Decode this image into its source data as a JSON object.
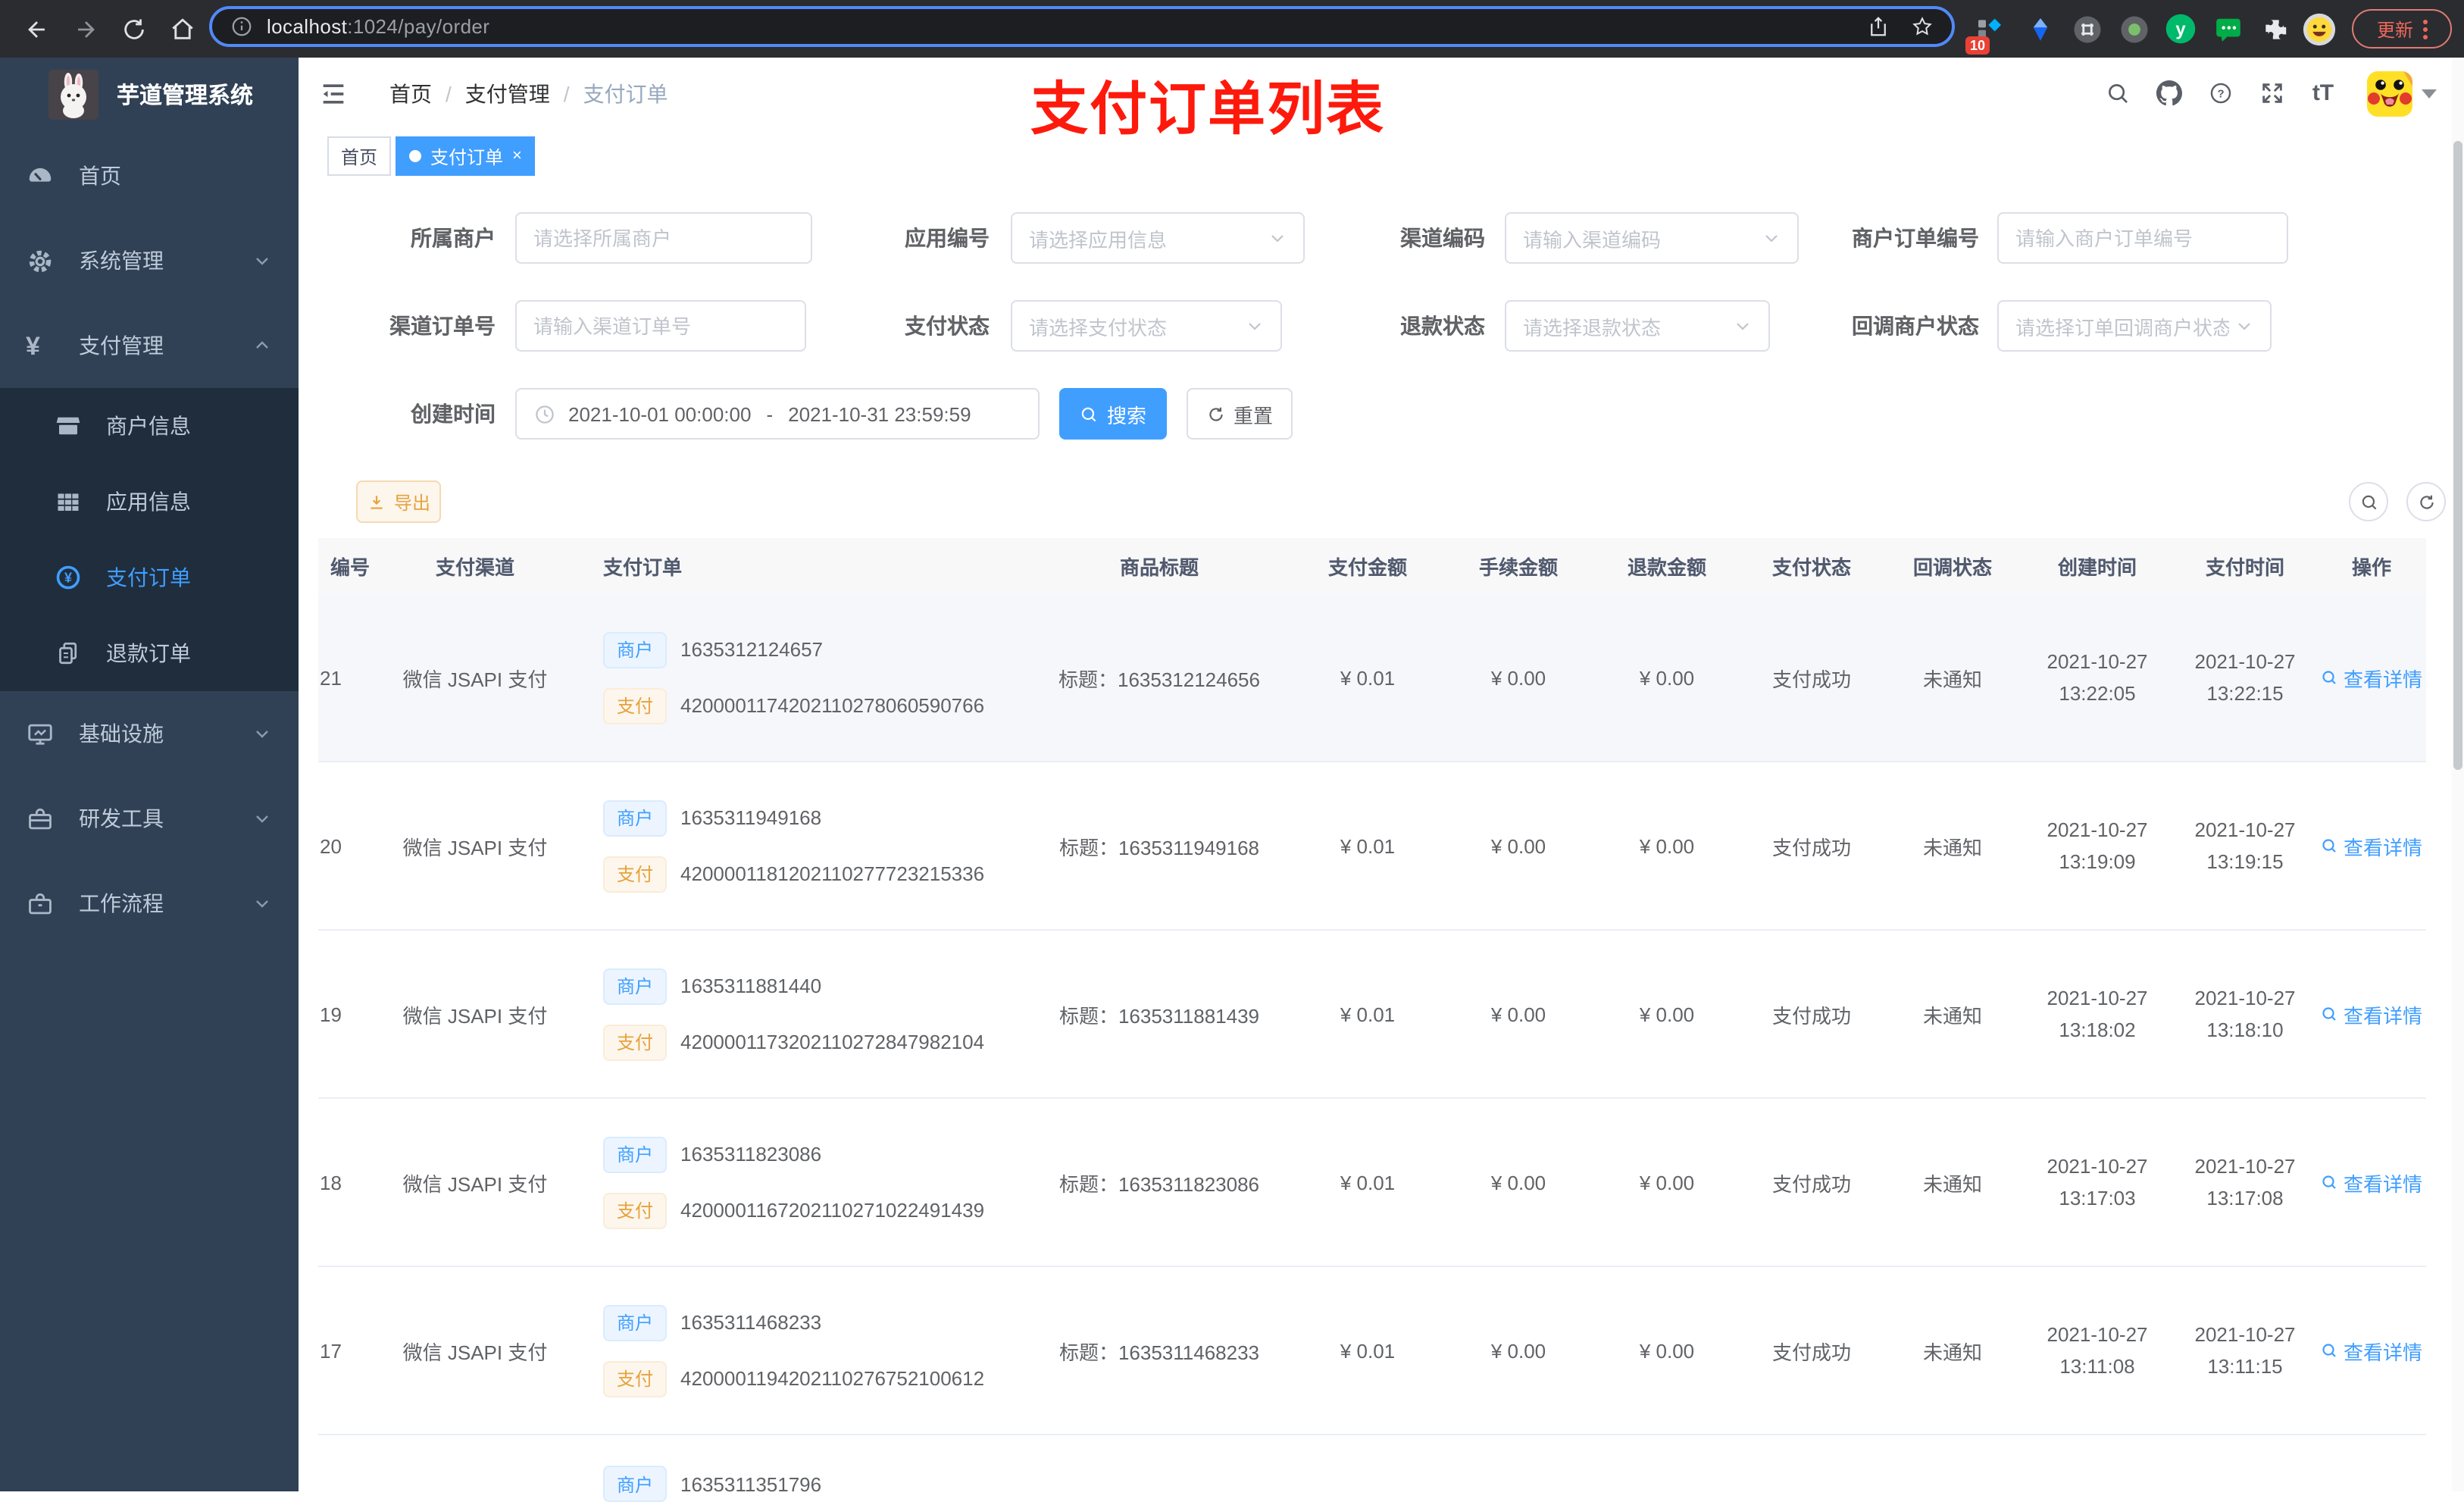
{
  "browser": {
    "url_host": "localhost",
    "url_path": ":1024/pay/order",
    "ext_badge": "10",
    "update_label": "更新"
  },
  "sidebar": {
    "title": "芋道管理系统",
    "items": [
      {
        "label": "首页",
        "icon": "dashboard-icon"
      },
      {
        "label": "系统管理",
        "icon": "gear-icon",
        "expand": "down"
      },
      {
        "label": "支付管理",
        "icon": "yen-icon",
        "expand": "up"
      },
      {
        "label": "商户信息",
        "icon": "shop-icon"
      },
      {
        "label": "应用信息",
        "icon": "grid-icon"
      },
      {
        "label": "支付订单",
        "icon": "yen-circle-icon",
        "active": true
      },
      {
        "label": "退款订单",
        "icon": "documents-icon"
      },
      {
        "label": "基础设施",
        "icon": "monitor-icon",
        "expand": "down"
      },
      {
        "label": "研发工具",
        "icon": "toolbox-icon",
        "expand": "down"
      },
      {
        "label": "工作流程",
        "icon": "briefcase-icon",
        "expand": "down"
      }
    ]
  },
  "header": {
    "breadcrumb": [
      "首页",
      "支付管理",
      "支付订单"
    ],
    "annotation": "支付订单列表",
    "font_icon": "tT"
  },
  "tabs": {
    "items": [
      {
        "label": "首页"
      },
      {
        "label": "支付订单",
        "active": true,
        "close": "×"
      }
    ]
  },
  "filters": {
    "items": [
      {
        "label": "所属商户",
        "placeholder": "请选择所属商户",
        "type": "input"
      },
      {
        "label": "应用编号",
        "placeholder": "请选择应用信息",
        "type": "select"
      },
      {
        "label": "渠道编码",
        "placeholder": "请输入渠道编码",
        "type": "select"
      },
      {
        "label": "商户订单编号",
        "placeholder": "请输入商户订单编号",
        "type": "input"
      },
      {
        "label": "渠道订单号",
        "placeholder": "请输入渠道订单号",
        "type": "input"
      },
      {
        "label": "支付状态",
        "placeholder": "请选择支付状态",
        "type": "select"
      },
      {
        "label": "退款状态",
        "placeholder": "请选择退款状态",
        "type": "select"
      },
      {
        "label": "回调商户状态",
        "placeholder": "请选择订单回调商户状态",
        "type": "select"
      }
    ],
    "date": {
      "label": "创建时间",
      "start": "2021-10-01 00:00:00",
      "separator": "-",
      "end": "2021-10-31 23:59:59"
    },
    "search_label": "搜索",
    "reset_label": "重置"
  },
  "toolbar": {
    "export_label": "导出"
  },
  "table": {
    "columns": [
      "编号",
      "支付渠道",
      "支付订单",
      "商品标题",
      "支付金额",
      "手续金额",
      "退款金额",
      "支付状态",
      "回调状态",
      "创建时间",
      "支付时间",
      "操作"
    ],
    "rows": [
      {
        "no": "21",
        "channel": "微信 JSAPI 支付",
        "merchant_tag": "商户",
        "merchant_no": "1635312124657",
        "pay_tag": "支付",
        "pay_no": "4200001174202110278060590766",
        "title": "标题：1635312124656",
        "amount": "¥ 0.01",
        "fee": "¥ 0.00",
        "refund": "¥ 0.00",
        "status": "支付成功",
        "notify": "未通知",
        "created_date": "2021-10-27",
        "created_time": "13:22:05",
        "paid_date": "2021-10-27",
        "paid_time": "13:22:15",
        "action": "查看详情",
        "highlight": true
      },
      {
        "no": "20",
        "channel": "微信 JSAPI 支付",
        "merchant_tag": "商户",
        "merchant_no": "1635311949168",
        "pay_tag": "支付",
        "pay_no": "4200001181202110277723215336",
        "title": "标题：1635311949168",
        "amount": "¥ 0.01",
        "fee": "¥ 0.00",
        "refund": "¥ 0.00",
        "status": "支付成功",
        "notify": "未通知",
        "created_date": "2021-10-27",
        "created_time": "13:19:09",
        "paid_date": "2021-10-27",
        "paid_time": "13:19:15",
        "action": "查看详情"
      },
      {
        "no": "19",
        "channel": "微信 JSAPI 支付",
        "merchant_tag": "商户",
        "merchant_no": "1635311881440",
        "pay_tag": "支付",
        "pay_no": "4200001173202110272847982104",
        "title": "标题：1635311881439",
        "amount": "¥ 0.01",
        "fee": "¥ 0.00",
        "refund": "¥ 0.00",
        "status": "支付成功",
        "notify": "未通知",
        "created_date": "2021-10-27",
        "created_time": "13:18:02",
        "paid_date": "2021-10-27",
        "paid_time": "13:18:10",
        "action": "查看详情"
      },
      {
        "no": "18",
        "channel": "微信 JSAPI 支付",
        "merchant_tag": "商户",
        "merchant_no": "1635311823086",
        "pay_tag": "支付",
        "pay_no": "4200001167202110271022491439",
        "title": "标题：1635311823086",
        "amount": "¥ 0.01",
        "fee": "¥ 0.00",
        "refund": "¥ 0.00",
        "status": "支付成功",
        "notify": "未通知",
        "created_date": "2021-10-27",
        "created_time": "13:17:03",
        "paid_date": "2021-10-27",
        "paid_time": "13:17:08",
        "action": "查看详情"
      },
      {
        "no": "17",
        "channel": "微信 JSAPI 支付",
        "merchant_tag": "商户",
        "merchant_no": "1635311468233",
        "pay_tag": "支付",
        "pay_no": "4200001194202110276752100612",
        "title": "标题：1635311468233",
        "amount": "¥ 0.01",
        "fee": "¥ 0.00",
        "refund": "¥ 0.00",
        "status": "支付成功",
        "notify": "未通知",
        "created_date": "2021-10-27",
        "created_time": "13:11:08",
        "paid_date": "2021-10-27",
        "paid_time": "13:11:15",
        "action": "查看详情"
      }
    ],
    "partial_row": {
      "merchant_tag": "商户",
      "merchant_no": "1635311351796"
    }
  },
  "colors": {
    "accent": "#409eff",
    "warning": "#e6a23c",
    "sidebar_bg": "#304156",
    "submenu_bg": "#1f2d3d",
    "annotation_red": "#fd1a0c",
    "chrome_bg": "#2b2c30",
    "tag_blue_bg": "#ecf5ff",
    "tag_yellow_bg": "#fdf6ec",
    "table_header_bg": "#f8f8f9",
    "row_hover_bg": "#f5f7fa"
  }
}
